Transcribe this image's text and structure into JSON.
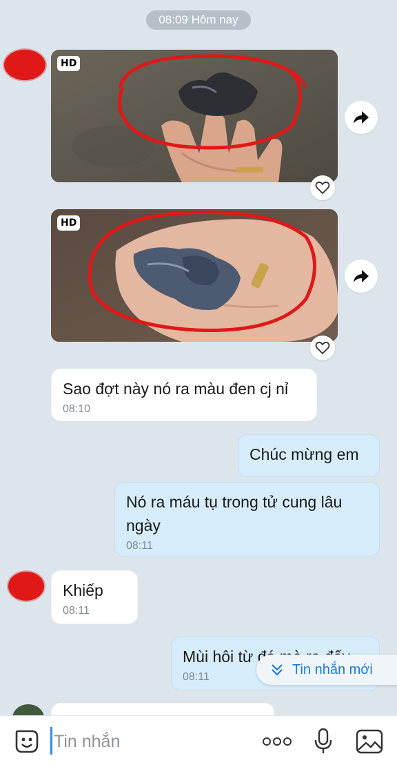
{
  "date_separator": "08:09 Hôm nay",
  "photos": [
    {
      "badge": "HD"
    },
    {
      "badge": "HD"
    }
  ],
  "messages": [
    {
      "direction": "in",
      "text": "Sao đợt này nó ra màu đen cj nỉ",
      "time": "08:10"
    },
    {
      "direction": "out",
      "text": "Chúc mừng em",
      "time": ""
    },
    {
      "direction": "out",
      "text": "Nó ra máu tụ trong tử cung lâu ngày",
      "time": "08:11"
    },
    {
      "direction": "in",
      "text": "Khiếp",
      "time": "08:11"
    },
    {
      "direction": "out",
      "text": "Mùi hôi từ đó mà ra đấy",
      "time": "08:11"
    }
  ],
  "new_messages_label": "Tin nhắn mới",
  "composer": {
    "placeholder": "Tin nhắn"
  },
  "icons": {
    "forward": "forward-arrow-icon",
    "like": "heart-icon",
    "sticker": "sticker-face-icon",
    "more": "more-dots-icon",
    "voice": "microphone-icon",
    "image": "image-gallery-icon",
    "new_messages": "double-chevron-down-icon"
  },
  "colors": {
    "chat_background": "#dde5ec",
    "incoming_bubble": "#ffffff",
    "outgoing_bubble": "#d6ecfb",
    "accent": "#1e7ad6",
    "annotation_red": "#e01818"
  }
}
